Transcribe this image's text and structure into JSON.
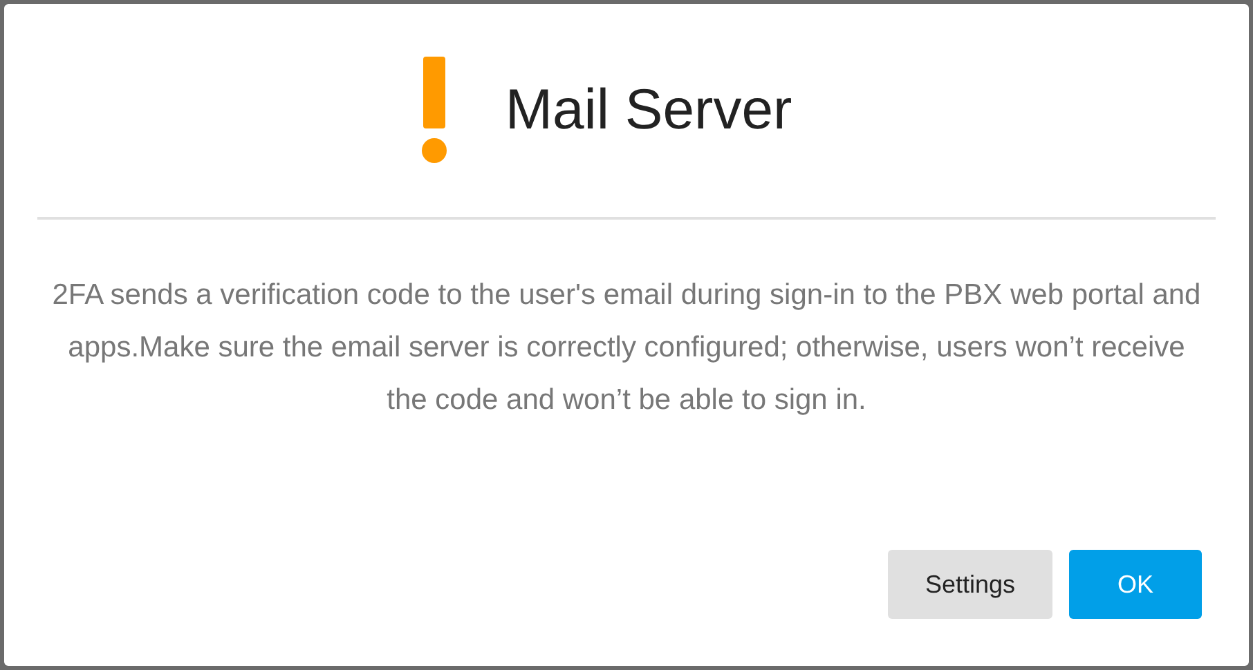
{
  "dialog": {
    "title": "Mail Server",
    "message": "2FA sends a verification code to the user's email during sign-in to the PBX web portal and apps.Make sure the email server is correctly configured; otherwise, users won’t receive the code and won’t be able to sign in.",
    "buttons": [
      {
        "label": "Settings",
        "kind": "secondary"
      },
      {
        "label": "OK",
        "kind": "primary"
      }
    ]
  }
}
